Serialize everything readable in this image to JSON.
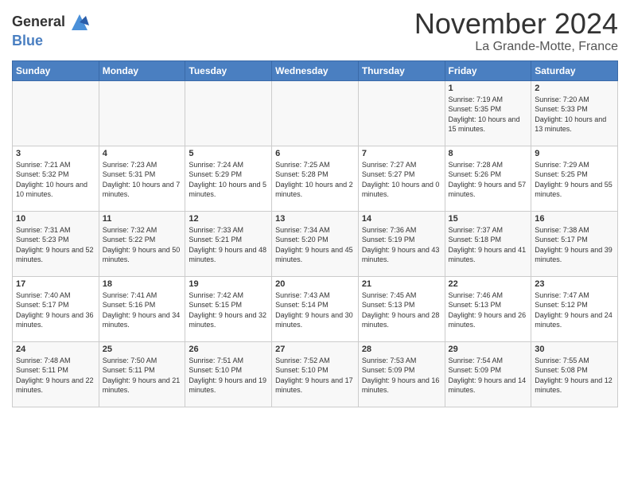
{
  "logo": {
    "line1": "General",
    "line2": "Blue"
  },
  "title": "November 2024",
  "location": "La Grande-Motte, France",
  "weekdays": [
    "Sunday",
    "Monday",
    "Tuesday",
    "Wednesday",
    "Thursday",
    "Friday",
    "Saturday"
  ],
  "weeks": [
    [
      {
        "day": "",
        "info": ""
      },
      {
        "day": "",
        "info": ""
      },
      {
        "day": "",
        "info": ""
      },
      {
        "day": "",
        "info": ""
      },
      {
        "day": "",
        "info": ""
      },
      {
        "day": "1",
        "info": "Sunrise: 7:19 AM\nSunset: 5:35 PM\nDaylight: 10 hours and 15 minutes."
      },
      {
        "day": "2",
        "info": "Sunrise: 7:20 AM\nSunset: 5:33 PM\nDaylight: 10 hours and 13 minutes."
      }
    ],
    [
      {
        "day": "3",
        "info": "Sunrise: 7:21 AM\nSunset: 5:32 PM\nDaylight: 10 hours and 10 minutes."
      },
      {
        "day": "4",
        "info": "Sunrise: 7:23 AM\nSunset: 5:31 PM\nDaylight: 10 hours and 7 minutes."
      },
      {
        "day": "5",
        "info": "Sunrise: 7:24 AM\nSunset: 5:29 PM\nDaylight: 10 hours and 5 minutes."
      },
      {
        "day": "6",
        "info": "Sunrise: 7:25 AM\nSunset: 5:28 PM\nDaylight: 10 hours and 2 minutes."
      },
      {
        "day": "7",
        "info": "Sunrise: 7:27 AM\nSunset: 5:27 PM\nDaylight: 10 hours and 0 minutes."
      },
      {
        "day": "8",
        "info": "Sunrise: 7:28 AM\nSunset: 5:26 PM\nDaylight: 9 hours and 57 minutes."
      },
      {
        "day": "9",
        "info": "Sunrise: 7:29 AM\nSunset: 5:25 PM\nDaylight: 9 hours and 55 minutes."
      }
    ],
    [
      {
        "day": "10",
        "info": "Sunrise: 7:31 AM\nSunset: 5:23 PM\nDaylight: 9 hours and 52 minutes."
      },
      {
        "day": "11",
        "info": "Sunrise: 7:32 AM\nSunset: 5:22 PM\nDaylight: 9 hours and 50 minutes."
      },
      {
        "day": "12",
        "info": "Sunrise: 7:33 AM\nSunset: 5:21 PM\nDaylight: 9 hours and 48 minutes."
      },
      {
        "day": "13",
        "info": "Sunrise: 7:34 AM\nSunset: 5:20 PM\nDaylight: 9 hours and 45 minutes."
      },
      {
        "day": "14",
        "info": "Sunrise: 7:36 AM\nSunset: 5:19 PM\nDaylight: 9 hours and 43 minutes."
      },
      {
        "day": "15",
        "info": "Sunrise: 7:37 AM\nSunset: 5:18 PM\nDaylight: 9 hours and 41 minutes."
      },
      {
        "day": "16",
        "info": "Sunrise: 7:38 AM\nSunset: 5:17 PM\nDaylight: 9 hours and 39 minutes."
      }
    ],
    [
      {
        "day": "17",
        "info": "Sunrise: 7:40 AM\nSunset: 5:17 PM\nDaylight: 9 hours and 36 minutes."
      },
      {
        "day": "18",
        "info": "Sunrise: 7:41 AM\nSunset: 5:16 PM\nDaylight: 9 hours and 34 minutes."
      },
      {
        "day": "19",
        "info": "Sunrise: 7:42 AM\nSunset: 5:15 PM\nDaylight: 9 hours and 32 minutes."
      },
      {
        "day": "20",
        "info": "Sunrise: 7:43 AM\nSunset: 5:14 PM\nDaylight: 9 hours and 30 minutes."
      },
      {
        "day": "21",
        "info": "Sunrise: 7:45 AM\nSunset: 5:13 PM\nDaylight: 9 hours and 28 minutes."
      },
      {
        "day": "22",
        "info": "Sunrise: 7:46 AM\nSunset: 5:13 PM\nDaylight: 9 hours and 26 minutes."
      },
      {
        "day": "23",
        "info": "Sunrise: 7:47 AM\nSunset: 5:12 PM\nDaylight: 9 hours and 24 minutes."
      }
    ],
    [
      {
        "day": "24",
        "info": "Sunrise: 7:48 AM\nSunset: 5:11 PM\nDaylight: 9 hours and 22 minutes."
      },
      {
        "day": "25",
        "info": "Sunrise: 7:50 AM\nSunset: 5:11 PM\nDaylight: 9 hours and 21 minutes."
      },
      {
        "day": "26",
        "info": "Sunrise: 7:51 AM\nSunset: 5:10 PM\nDaylight: 9 hours and 19 minutes."
      },
      {
        "day": "27",
        "info": "Sunrise: 7:52 AM\nSunset: 5:10 PM\nDaylight: 9 hours and 17 minutes."
      },
      {
        "day": "28",
        "info": "Sunrise: 7:53 AM\nSunset: 5:09 PM\nDaylight: 9 hours and 16 minutes."
      },
      {
        "day": "29",
        "info": "Sunrise: 7:54 AM\nSunset: 5:09 PM\nDaylight: 9 hours and 14 minutes."
      },
      {
        "day": "30",
        "info": "Sunrise: 7:55 AM\nSunset: 5:08 PM\nDaylight: 9 hours and 12 minutes."
      }
    ]
  ]
}
